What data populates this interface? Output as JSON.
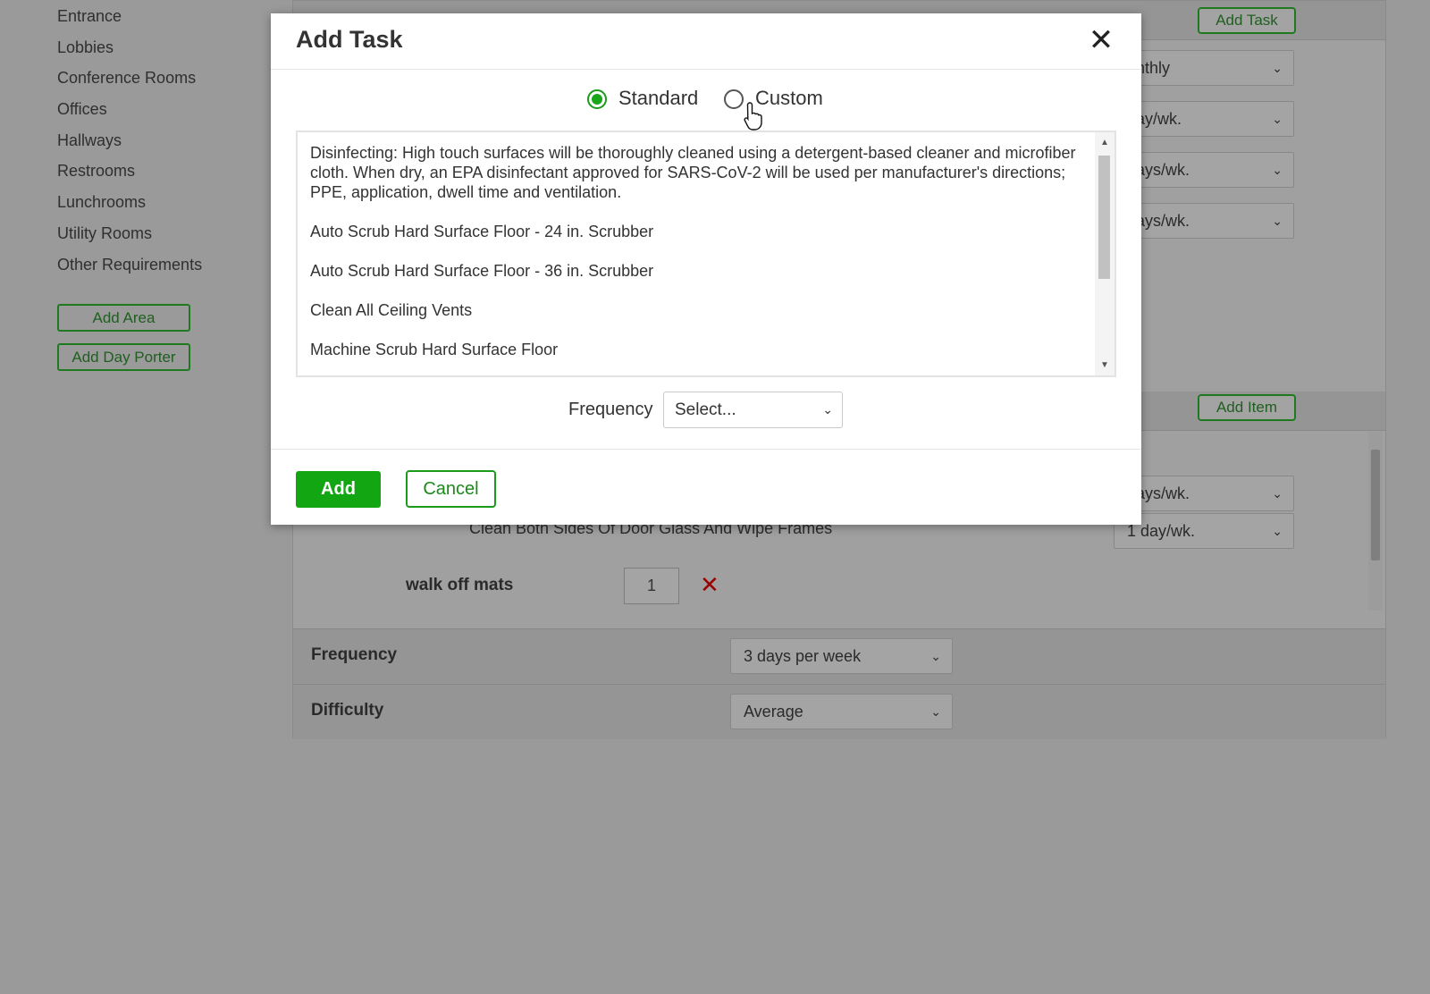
{
  "sidebar": {
    "items": [
      "Entrance",
      "Lobbies",
      "Conference Rooms",
      "Offices",
      "Hallways",
      "Restrooms",
      "Lunchrooms",
      "Utility Rooms",
      "Other Requirements"
    ],
    "add_area": "Add Area",
    "add_day_porter": "Add Day Porter"
  },
  "background": {
    "add_task": "Add Task",
    "add_item": "Add Item",
    "task_freqs": [
      "onthly",
      "day/wk.",
      "days/wk.",
      "days/wk."
    ],
    "item_freqs": [
      "days/wk.",
      "1 day/wk."
    ],
    "item_text": "Clean Both Sides Of Door Glass And Wipe Frames",
    "walk_off_label": "walk off mats",
    "walk_off_qty": "1",
    "remove_glyph": "✕",
    "frequency_label": "Frequency",
    "frequency_value": "3 days per week",
    "difficulty_label": "Difficulty",
    "difficulty_value": "Average"
  },
  "modal": {
    "title": "Add Task",
    "close_glyph": "✕",
    "radio_standard": "Standard",
    "radio_custom": "Custom",
    "selected": "Standard",
    "tasks": [
      "Disinfecting: High touch surfaces will be thoroughly cleaned using a detergent-based cleaner and microfiber cloth. When dry, an EPA disinfectant approved for SARS-CoV-2 will be used per manufacturer's directions; PPE, application, dwell time and ventilation.",
      "Auto Scrub Hard Surface Floor - 24 in. Scrubber",
      "Auto Scrub Hard Surface Floor - 36 in. Scrubber",
      "Clean All Ceiling Vents",
      "Machine Scrub Hard Surface Floor"
    ],
    "frequency_label": "Frequency",
    "frequency_placeholder": "Select...",
    "add_button": "Add",
    "cancel_button": "Cancel"
  },
  "colors": {
    "accent_green": "#13a613",
    "overlay_gray": "#9a9a9a",
    "remove_red": "#9a0000"
  },
  "icons": {
    "close": "close-icon",
    "chevron": "chevron-down-icon",
    "cursor": "hand-cursor-icon",
    "remove": "remove-icon"
  }
}
